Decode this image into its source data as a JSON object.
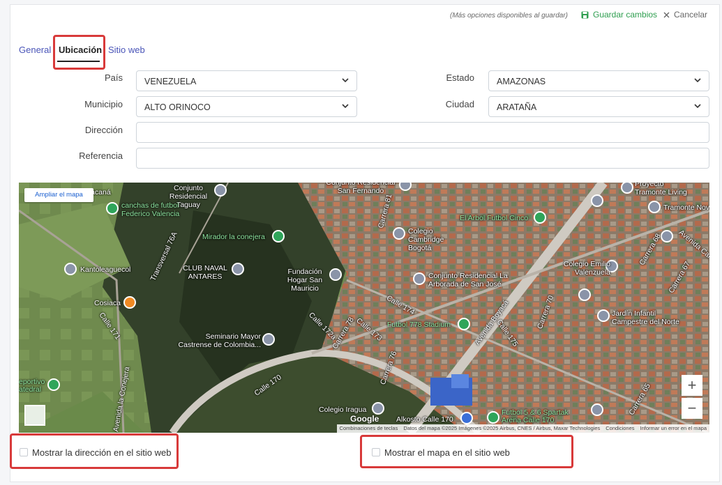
{
  "header": {
    "hint": "(Más opciones disponibles al guardar)",
    "save_label": "Guardar cambios",
    "cancel_label": "Cancelar"
  },
  "tabs": [
    {
      "label": "General"
    },
    {
      "label": "Ubicación",
      "active": true
    },
    {
      "label": "Sitio web"
    }
  ],
  "form": {
    "pais_label": "País",
    "pais_value": "VENEZUELA",
    "estado_label": "Estado",
    "estado_value": "AMAZONAS",
    "municipio_label": "Municipio",
    "municipio_value": "ALTO ORINOCO",
    "ciudad_label": "Ciudad",
    "ciudad_value": "ARATAÑA",
    "direccion_label": "Dirección",
    "direccion_value": "",
    "referencia_label": "Referencia",
    "referencia_value": ""
  },
  "map": {
    "expand_label": "Ampliar el mapa",
    "zoom_in": "+",
    "zoom_out": "−",
    "google": "Google",
    "attribution": {
      "shortcuts": "Combinaciones de teclas",
      "data": "Datos del mapa ©2025 Imágenes ©2025 Airbus, CNES / Airbus, Maxar Technologies",
      "terms": "Condiciones",
      "report": "Informar un error en el mapa"
    },
    "labels": [
      "Maracaná",
      "Conjunto Residencial Taguay",
      "canchas de futbol Federico Valencia",
      "Conjunto Residencial San Fernando",
      "Proyecto Tramonte Living",
      "Tramonte Nov",
      "Mirador la conejera",
      "El Arbol Futbol Cinco",
      "Colegio Cambridge Bogotá",
      "Kantoleaguecol",
      "CLUB NAVAL ANTARES",
      "Fundación Hogar San Mauricio",
      "Conjunto Residencial La Arborada de San José",
      "Colegio Emilio Valenzuela",
      "Cosiaca",
      "Jardín Infantil Campestre del Norte",
      "Futbol 778 Stadium",
      "Seminario Mayor Castrense de Colombia...",
      "eportivo atedral",
      "Colegio Iragua",
      "Alkosto Calle 170",
      "Futbol 5 & 6 Spartak Arena Calle 170",
      "Transversal 76A",
      "Calle 171",
      "Avenida la Conejera",
      "Carrera 81",
      "Calle 174",
      "Calle 173",
      "Calle 172a",
      "Carrera 78",
      "Calle 170",
      "Avenida Boyacá",
      "Calle 175",
      "Carrera 70",
      "Carrera 68",
      "Avenida Calle",
      "Carrera 67",
      "Carrera 65",
      "Carrera 76"
    ]
  },
  "options": {
    "show_address": "Mostrar la dirección en el sitio web",
    "show_map": "Mostrar el mapa en el sitio web"
  },
  "colors": {
    "accent": "#4a55b8",
    "save": "#2e9e4f",
    "highlight": "#d83a3a"
  }
}
